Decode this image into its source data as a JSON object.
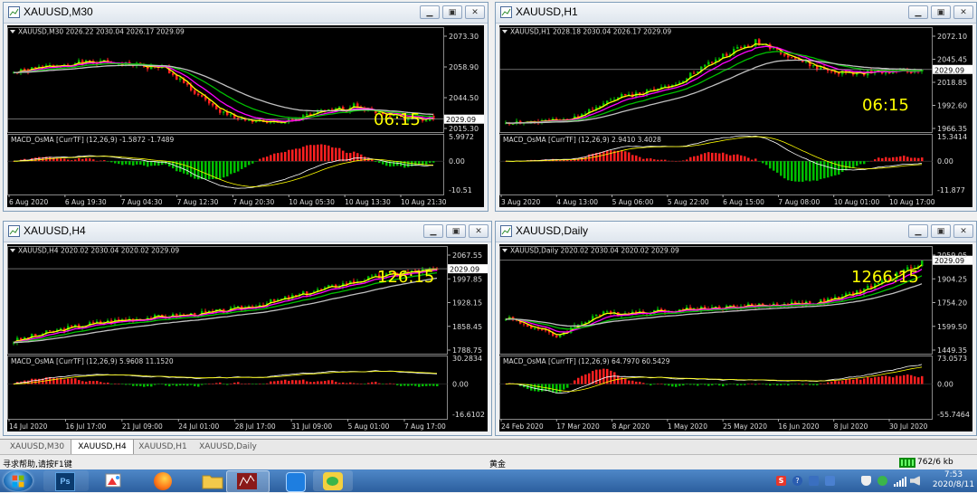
{
  "windows": [
    {
      "title": "XAUUSD,M30",
      "info": "XAUUSD,M30  2026.22 2030.04 2026.17 2029.09",
      "macd_label": "MACD_OsMA [CurrTF] (12,26,9) -1.5872 -1.7489",
      "timer": "06:15",
      "price_label": "2029.09",
      "price_ticks": [
        "2073.30",
        "2058.90",
        "2044.50",
        "2015.30"
      ],
      "macd_ticks": [
        "5.9972",
        "0.00",
        "-10.51"
      ],
      "time_ticks": [
        "6 Aug 2020",
        "6 Aug 19:30",
        "7 Aug 04:30",
        "7 Aug 12:30",
        "7 Aug 20:30",
        "10 Aug 05:30",
        "10 Aug 13:30",
        "10 Aug 21:30"
      ]
    },
    {
      "title": "XAUUSD,H1",
      "info": "XAUUSD,H1  2028.18 2030.04 2026.17 2029.09",
      "macd_label": "MACD_OsMA [CurrTF] (12,26,9) 2.9410 3.4028",
      "timer": "06:15",
      "price_label": "2029.09",
      "price_ticks": [
        "2072.10",
        "2045.45",
        "2018.85",
        "1992.60",
        "1966.35"
      ],
      "macd_ticks": [
        "15.3414",
        "0.00",
        "-11.877"
      ],
      "time_ticks": [
        "3 Aug 2020",
        "4 Aug 13:00",
        "5 Aug 06:00",
        "5 Aug 22:00",
        "6 Aug 15:00",
        "7 Aug 08:00",
        "10 Aug 01:00",
        "10 Aug 17:00"
      ]
    },
    {
      "title": "XAUUSD,H4",
      "info": "XAUUSD,H4  2020.02 2030.04 2020.02 2029.09",
      "macd_label": "MACD_OsMA [CurrTF] (12,26,9) 5.9608 11.1520",
      "timer": "126:15",
      "price_label": "2029.09",
      "price_ticks": [
        "2067.55",
        "1997.85",
        "1928.15",
        "1858.45",
        "1788.75"
      ],
      "macd_ticks": [
        "30.2834",
        "0.00",
        "-16.6102"
      ],
      "time_ticks": [
        "14 Jul 2020",
        "16 Jul 17:00",
        "21 Jul 09:00",
        "24 Jul 01:00",
        "28 Jul 17:00",
        "31 Jul 09:00",
        "5 Aug 01:00",
        "7 Aug 17:00"
      ]
    },
    {
      "title": "XAUUSD,Daily",
      "info": "XAUUSD,Daily  2020.02 2030.04 2020.02 2029.09",
      "macd_label": "MACD_OsMA [CurrTF] (12,26,9) 64.7970 60.5429",
      "timer": "1266:15",
      "price_label": "2029.09",
      "price_ticks": [
        "2059.05",
        "1904.25",
        "1754.20",
        "1599.50",
        "1449.35"
      ],
      "macd_ticks": [
        "73.0573",
        "0.00",
        "-55.7464"
      ],
      "time_ticks": [
        "24 Feb 2020",
        "17 Mar 2020",
        "8 Apr 2020",
        "1 May 2020",
        "25 May 2020",
        "16 Jun 2020",
        "8 Jul 2020",
        "30 Jul 2020"
      ]
    }
  ],
  "tabs": [
    "XAUUSD,M30",
    "XAUUSD,H4",
    "XAUUSD,H1",
    "XAUUSD,Daily"
  ],
  "active_tab": "XAUUSD,H4",
  "status": {
    "help": "寻求帮助,请按F1键",
    "profile": "黄金",
    "traffic": "762/6 kb"
  },
  "taskbar": {
    "time": "7:53",
    "date": "2020/8/11"
  },
  "colors": {
    "up_candle": "#00c000",
    "down_candle": "#ff2020",
    "ma_fast": "#ffff00",
    "ma_mid": "#ff00ff",
    "ma_slow": "#00c000",
    "ma_long": "#c0c0c0",
    "timer": "#ffff00"
  }
}
